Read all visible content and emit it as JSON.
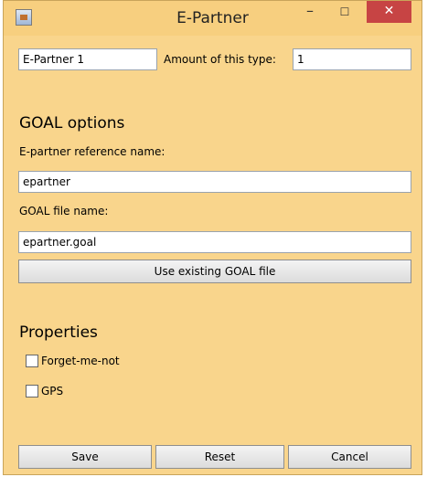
{
  "window": {
    "title": "E-Partner",
    "minimize": "–",
    "maximize": "☐",
    "close": "✕"
  },
  "top": {
    "name_value": "E-Partner 1",
    "amount_label": "Amount of this type:",
    "amount_value": "1"
  },
  "goal": {
    "heading": "GOAL options",
    "ref_label": "E-partner reference name:",
    "ref_value": "epartner",
    "file_label": "GOAL file name:",
    "file_value": "epartner.goal",
    "use_existing": "Use existing GOAL file"
  },
  "properties": {
    "heading": "Properties",
    "items": [
      {
        "label": "Forget-me-not",
        "checked": false
      },
      {
        "label": "GPS",
        "checked": false
      }
    ]
  },
  "footer": {
    "save": "Save",
    "reset": "Reset",
    "cancel": "Cancel"
  }
}
